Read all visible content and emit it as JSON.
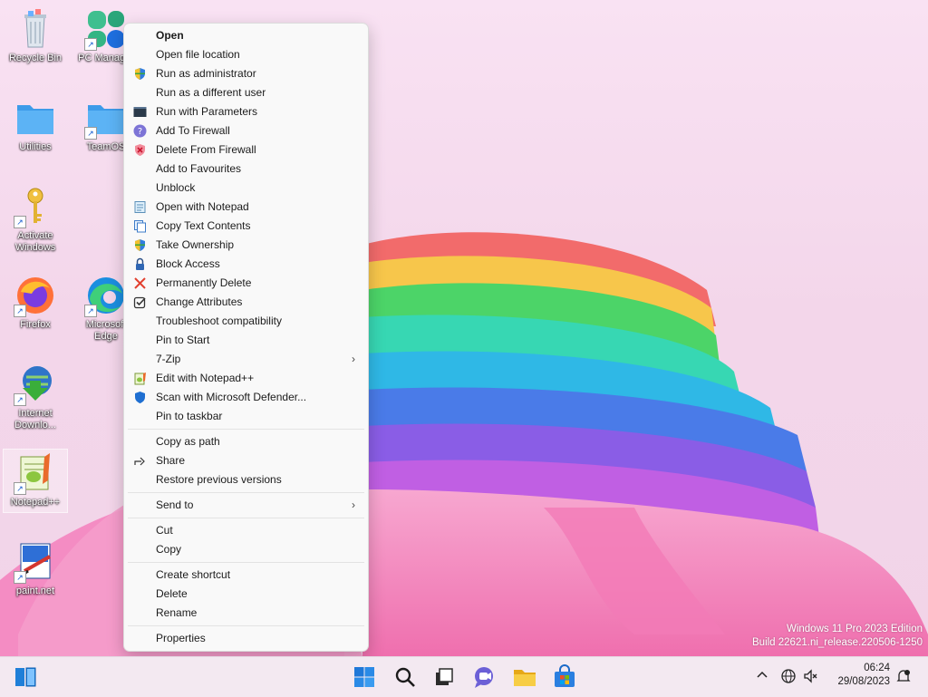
{
  "desktop": {
    "icons": [
      {
        "label": "Recycle Bin"
      },
      {
        "label": "PC Manager"
      },
      {
        "label": "Utilities"
      },
      {
        "label": "TeamOS"
      },
      {
        "label": "Activate Windows"
      },
      {
        "label": "Firefox"
      },
      {
        "label": "Microsoft Edge"
      },
      {
        "label": "Internet Downlo..."
      },
      {
        "label": "Notepad++"
      },
      {
        "label": "paint.net"
      }
    ]
  },
  "context_menu": {
    "items": [
      {
        "label": "Open",
        "icon": "none"
      },
      {
        "label": "Open file location",
        "icon": "none"
      },
      {
        "label": "Run as administrator",
        "icon": "shield-icon"
      },
      {
        "label": "Run as a different user",
        "icon": "none"
      },
      {
        "label": "Run with Parameters",
        "icon": "terminal-icon"
      },
      {
        "label": "Add To Firewall",
        "icon": "help-circle-icon"
      },
      {
        "label": "Delete From Firewall",
        "icon": "firewall-x-icon"
      },
      {
        "label": "Add to Favourites",
        "icon": "none"
      },
      {
        "label": "Unblock",
        "icon": "none"
      },
      {
        "label": "Open with Notepad",
        "icon": "notepad-icon"
      },
      {
        "label": "Copy Text Contents",
        "icon": "copy-doc-icon"
      },
      {
        "label": "Take Ownership",
        "icon": "shield-icon"
      },
      {
        "label": "Block Access",
        "icon": "lock-icon"
      },
      {
        "label": "Permanently Delete",
        "icon": "red-x-icon"
      },
      {
        "label": "Change Attributes",
        "icon": "checkbox-icon"
      },
      {
        "label": "Troubleshoot compatibility",
        "icon": "none"
      },
      {
        "label": "Pin to Start",
        "icon": "none"
      },
      {
        "label": "7-Zip",
        "icon": "none"
      },
      {
        "label": "Edit with Notepad++",
        "icon": "notepadpp-icon"
      },
      {
        "label": "Scan with Microsoft Defender...",
        "icon": "defender-icon"
      },
      {
        "label": "Pin to taskbar",
        "icon": "none"
      },
      {
        "label": "Copy as path",
        "icon": "none"
      },
      {
        "label": "Share",
        "icon": "share-icon"
      },
      {
        "label": "Restore previous versions",
        "icon": "none"
      },
      {
        "label": "Send to",
        "icon": "none"
      },
      {
        "label": "Cut",
        "icon": "none"
      },
      {
        "label": "Copy",
        "icon": "none"
      },
      {
        "label": "Create shortcut",
        "icon": "none"
      },
      {
        "label": "Delete",
        "icon": "none"
      },
      {
        "label": "Rename",
        "icon": "none"
      },
      {
        "label": "Properties",
        "icon": "none"
      }
    ]
  },
  "watermark": {
    "line1": "Windows 11 Pro.2023 Edition",
    "line2": "Build 22621.ni_release.220506-1250"
  },
  "taskbar": {
    "clock_time": "06:24",
    "clock_date": "29/08/2023"
  },
  "colors": {
    "menu_bg": "#f9f9f9",
    "taskbar_bg": "#f3e9f1",
    "accent": "#0067c0"
  }
}
